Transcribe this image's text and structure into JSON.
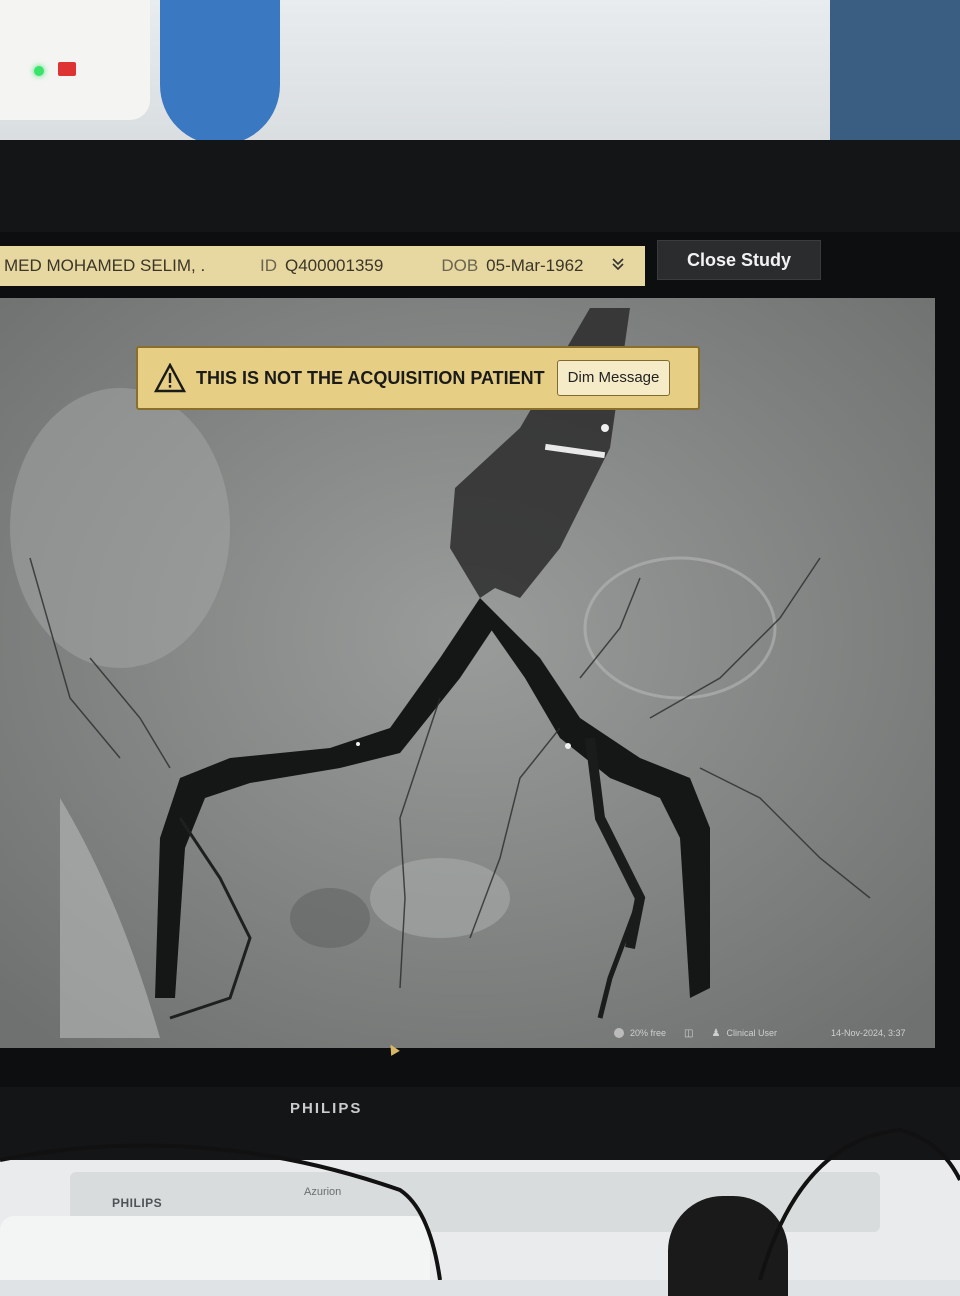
{
  "patient_bar": {
    "name": "MED MOHAMED SELIM, .",
    "id_label": "ID",
    "id_value": "Q400001359",
    "dob_label": "DOB",
    "dob_value": "05-Mar-1962",
    "expand_icon": "chevron-double-down-icon"
  },
  "close_study_label": "Close Study",
  "warning": {
    "icon": "warning-triangle-icon",
    "text": "THIS IS NOT THE ACQUISITION PATIENT",
    "dim_button_label": "Dim Message"
  },
  "status_bar": {
    "disk_free": "20% free",
    "user": "Clinical User",
    "datetime": "14-Nov-2024, 3:37"
  },
  "monitor_brand": "PHILIPS",
  "console": {
    "brand": "PHILIPS",
    "model": "Azurion"
  },
  "colors": {
    "patient_bar_bg": "#e7d7a0",
    "warning_bg": "#e6cf85",
    "close_study_bg": "#2a2c2e"
  }
}
